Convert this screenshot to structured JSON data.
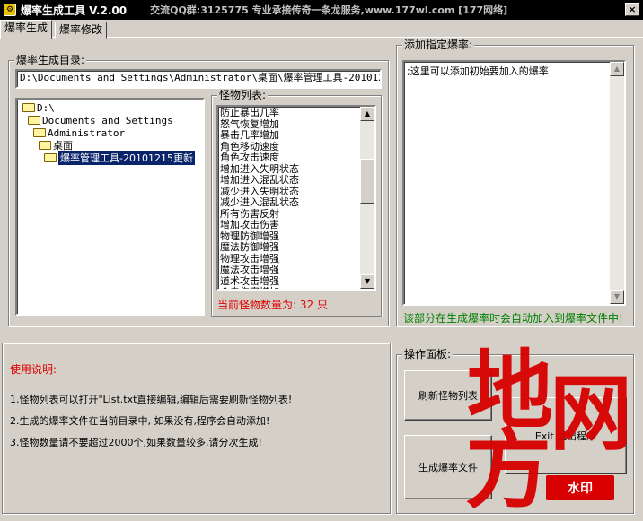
{
  "window": {
    "title": "爆率生成工具 V.2.00",
    "title_extra": "交流QQ群:3125775   专业承接传奇一条龙服务,www.177wl.com [177网络]",
    "close_glyph": "×"
  },
  "tabs": [
    {
      "label": "爆率生成",
      "active": true
    },
    {
      "label": "爆率修改",
      "active": false
    }
  ],
  "generate_dir": {
    "label": "爆率生成目录:",
    "path": "D:\\Documents and Settings\\Administrator\\桌面\\爆率管理工具-20101215更",
    "tree": [
      {
        "label": "D:\\",
        "depth": 0
      },
      {
        "label": "Documents and Settings",
        "depth": 1
      },
      {
        "label": "Administrator",
        "depth": 2
      },
      {
        "label": "桌面",
        "depth": 3
      },
      {
        "label": "爆率管理工具-20101215更新",
        "depth": 4,
        "selected": true
      }
    ]
  },
  "monster_list": {
    "label": "怪物列表:",
    "items": [
      "防止暴出几率",
      "怒气恢复增加",
      "暴击几率增加",
      "角色移动速度",
      "角色攻击速度",
      "增加进入失明状态",
      "增加进入混乱状态",
      "减少进入失明状态",
      "减少进入混乱状态",
      "所有伤害反射",
      "增加攻击伤害",
      "物理防御增强",
      "魔法防御增强",
      "物理攻击增强",
      "魔法攻击增强",
      "道术攻击增强",
      "合击伤害增加"
    ],
    "count_text": "当前怪物数量为: 32 只",
    "scroll_up": "▲",
    "scroll_down": "▼"
  },
  "add_rate": {
    "label": "添加指定爆率:",
    "content": ";这里可以添加初始要加入的爆率",
    "note": "该部分在生成爆率时会自动加入到爆率文件中!"
  },
  "usage": {
    "title": "使用说明:",
    "lines": [
      "1.怪物列表可以打开\"List.txt直接编辑,编辑后需要刷新怪物列表!",
      "2.生成的爆率文件在当前目录中, 如果没有,程序会自动添加!",
      "3.怪物数量请不要超过2000个,如果数量较多,请分次生成!"
    ]
  },
  "operations": {
    "label": "操作面板:",
    "refresh_button": "刷新怪物列表",
    "exit_button": "Exit  退出程序",
    "generate_button": "生成爆率文件"
  },
  "watermark": {
    "chars": [
      "地",
      "网",
      "方"
    ],
    "badge": "水印"
  },
  "colors": {
    "title_bg": "#000000",
    "selection": "#0a246a",
    "red": "#e00000",
    "green": "#008000"
  }
}
